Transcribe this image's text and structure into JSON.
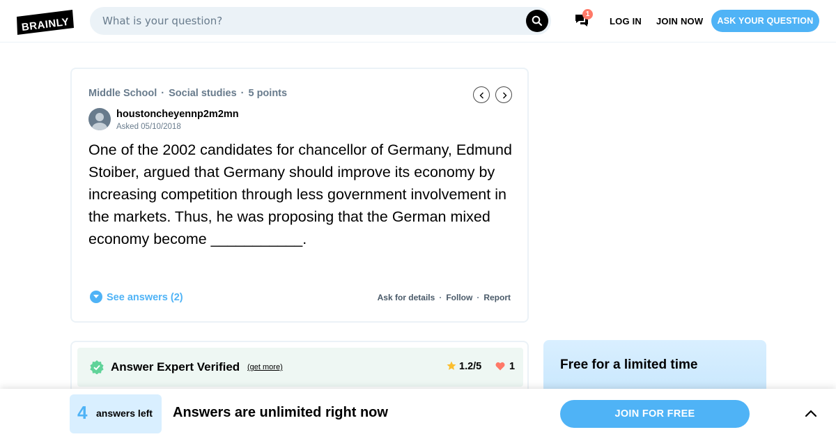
{
  "header": {
    "logo_text": "BRAINLY",
    "search_placeholder": "What is your question?",
    "notification_count": "1",
    "login_label": "LOG IN",
    "join_label": "JOIN NOW",
    "ask_label": "ASK YOUR QUESTION"
  },
  "question": {
    "level": "Middle School",
    "subject": "Social studies",
    "points": "5 points",
    "username": "houstoncheyennp2m2mn",
    "asked": "Asked 05/10/2018",
    "text": "One of the 2002 candidates for chancellor of Germany, Edmund Stoiber, argued that Germany should improve its economy by increasing competition through less government involvement in the markets. Thus, he was proposing that the German mixed economy become ___________.",
    "see_answers": "See answers (2)",
    "actions": [
      "Ask for details",
      "Follow",
      "Report"
    ]
  },
  "answer": {
    "title": "Answer Expert Verified",
    "get_more": "(get more)",
    "rating": "1.2/5",
    "thanks": "1"
  },
  "promo": {
    "title": "Free for a limited time"
  },
  "bottom_bar": {
    "answers_left_count": "4",
    "answers_left_label": "answers left",
    "message": "Answers are unlimited right now",
    "join_button": "JOIN FOR FREE"
  },
  "colors": {
    "brand_blue": "#4fb3f6",
    "verified_green": "#60d399",
    "heart_red": "#ff7968",
    "star_yellow": "#fbbe2e"
  }
}
